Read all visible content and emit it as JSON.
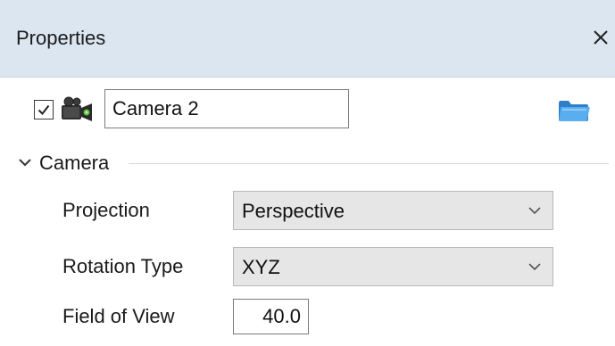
{
  "panel": {
    "title": "Properties",
    "close_icon": "close-icon"
  },
  "object": {
    "enabled": true,
    "type_icon": "camera-icon",
    "name": "Camera 2",
    "browse_icon": "folder-icon"
  },
  "camera_section": {
    "title": "Camera",
    "expanded": true,
    "projection_label": "Projection",
    "projection_value": "Perspective",
    "rotation_type_label": "Rotation Type",
    "rotation_type_value": "XYZ",
    "field_of_view_label": "Field of View",
    "field_of_view_value": "40.0"
  },
  "colors": {
    "titlebar_bg": "#dbe6f1",
    "dropdown_bg": "#e6e6e6",
    "folder_blue": "#3d8fd6"
  }
}
